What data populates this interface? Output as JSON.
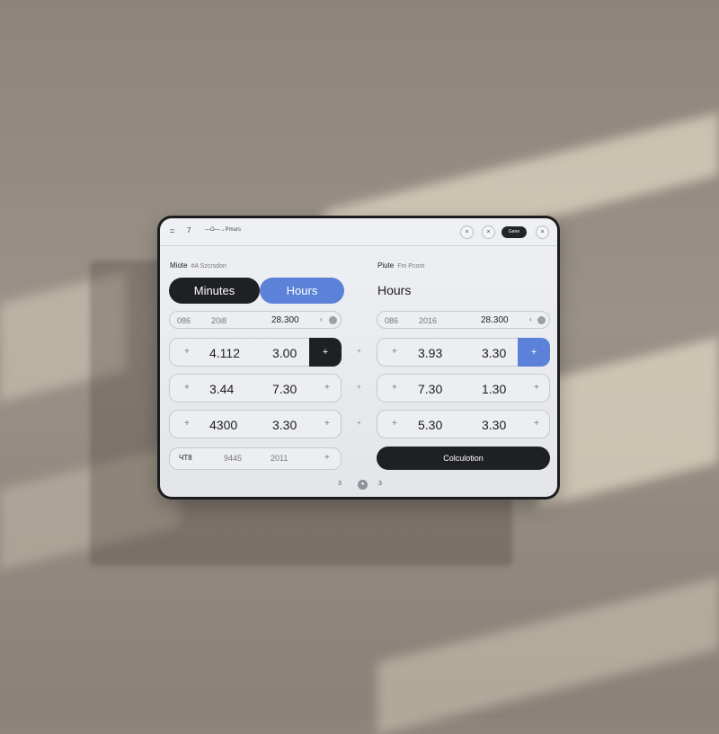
{
  "topbar": {
    "menu_icon": "menu-icon",
    "number": "7",
    "title": "—O—→Pmurs"
  },
  "window_controls": {
    "c1": "×",
    "c2": "×",
    "pill": "Gene",
    "close": "×"
  },
  "left_panel": {
    "label": "Miote",
    "label_sub": "#A Szcrsdon",
    "tabs": {
      "minutes": "Minutes",
      "hours": "Hours"
    },
    "input": {
      "a": "086",
      "b": "20i8",
      "value": "28.300",
      "chevron": "‹"
    },
    "rows": [
      {
        "plus": "+",
        "v1": "4.112",
        "v2": "3.00",
        "action": "+"
      },
      {
        "plus": "+",
        "v1": "3.44",
        "v2": "7.30",
        "end": "+"
      },
      {
        "plus": "+",
        "v1": "4300",
        "v2": "3.30",
        "end": "+"
      }
    ],
    "bottom": {
      "a": "ЧТ8",
      "b": "9445",
      "c": "2011",
      "end": "+"
    }
  },
  "mid_plus": [
    "+",
    "+",
    "+"
  ],
  "right_panel": {
    "label": "Piute",
    "label_sub": "Fm Pcont",
    "title": "Hours",
    "input": {
      "a": "086",
      "b": "2016",
      "value": "28.300",
      "chevron": "‹"
    },
    "rows": [
      {
        "plus": "+",
        "v1": "3.93",
        "v2": "3.30",
        "action": "+"
      },
      {
        "plus": "+",
        "v1": "7.30",
        "v2": "1.30",
        "end": "+"
      },
      {
        "plus": "+",
        "v1": "5.30",
        "v2": "3.30",
        "end": "+"
      }
    ],
    "calc_button": "Colculotion"
  },
  "pager": {
    "left": "3",
    "current": "●",
    "right": "3"
  },
  "colors": {
    "accent_blue": "#5b82d8",
    "dark": "#1f2023"
  }
}
